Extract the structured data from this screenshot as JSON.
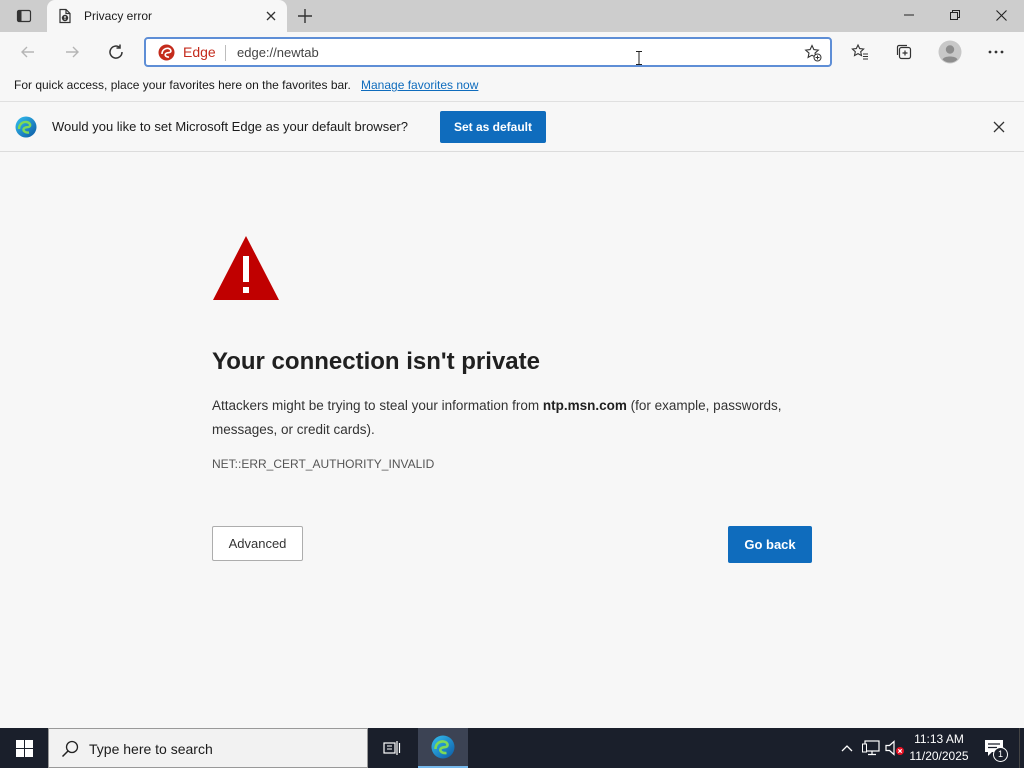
{
  "browser": {
    "tab": {
      "title": "Privacy error",
      "favicon": "warning-document-icon"
    },
    "address_bar": {
      "badge_label": "Edge",
      "url": "edge://newtab"
    },
    "window_controls": [
      "minimize-icon",
      "restore-icon",
      "close-icon"
    ],
    "toolbar_icons": [
      "back-icon",
      "forward-icon",
      "refresh-icon",
      "favorites-icon",
      "collections-icon",
      "profile-icon",
      "more-icon"
    ]
  },
  "favorites_bar": {
    "message": "For quick access, place your favorites here on the favorites bar.",
    "link": "Manage favorites now"
  },
  "infobar": {
    "message": "Would you like to set Microsoft Edge as your default browser?",
    "button": "Set as default"
  },
  "error_page": {
    "heading": "Your connection isn't private",
    "description_before": "Attackers might be trying to steal your information from ",
    "description_host": "ntp.msn.com",
    "description_after": " (for example, passwords, messages, or credit cards).",
    "error_code": "NET::ERR_CERT_AUTHORITY_INVALID",
    "advanced_button": "Advanced",
    "back_button": "Go back"
  },
  "taskbar": {
    "search_placeholder": "Type here to search",
    "clock_time": "11:13 AM",
    "clock_date": "11/20/2025",
    "notification_count": "1"
  },
  "colors": {
    "accent": "#0f6cbd",
    "warning": "#c00000",
    "taskbar": "#1a1f2b"
  }
}
